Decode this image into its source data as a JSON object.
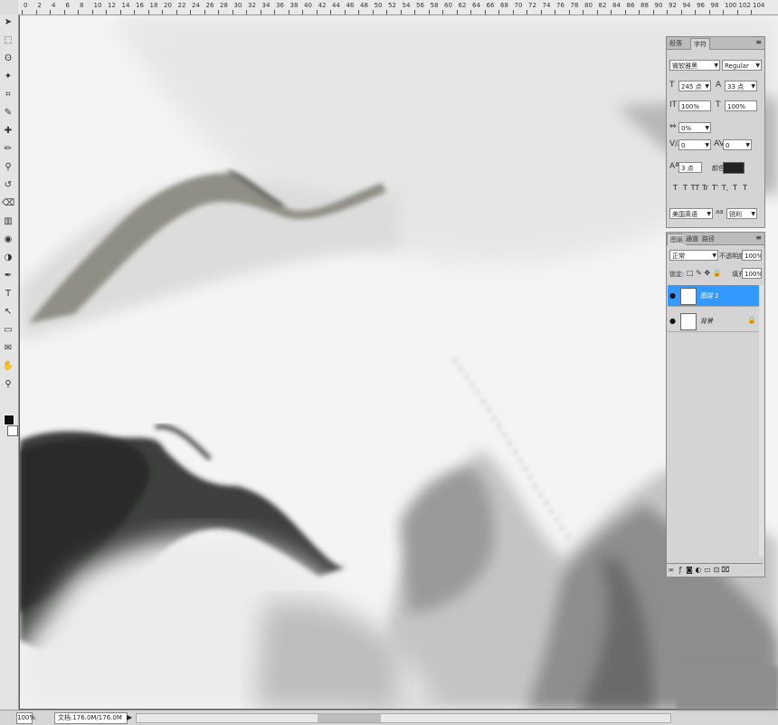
{
  "ruler": {
    "ticks": [
      "0",
      "2",
      "4",
      "6",
      "8",
      "10",
      "12",
      "14",
      "16",
      "18",
      "20",
      "22",
      "24",
      "26",
      "28",
      "30",
      "32",
      "34",
      "36",
      "38",
      "40",
      "42",
      "44",
      "46",
      "48",
      "50",
      "52",
      "54",
      "56",
      "58",
      "60",
      "62",
      "64",
      "66",
      "68",
      "70",
      "72",
      "74",
      "76",
      "78",
      "80",
      "82",
      "84",
      "86",
      "88",
      "90",
      "92",
      "94",
      "96",
      "98",
      "100",
      "102",
      "104"
    ]
  },
  "tools": [
    "move-tool-icon",
    "marquee-tool-icon",
    "lasso-tool-icon",
    "magic-wand-icon",
    "crop-tool-icon",
    "eyedropper-icon",
    "healing-brush-icon",
    "brush-tool-icon",
    "clone-stamp-icon",
    "history-brush-icon",
    "eraser-icon",
    "gradient-icon",
    "blur-tool-icon",
    "dodge-tool-icon",
    "pen-tool-icon",
    "type-tool-icon",
    "path-select-icon",
    "shape-tool-icon",
    "notes-icon",
    "hand-tool-icon",
    "zoom-tool-icon"
  ],
  "character": {
    "tabs": [
      "段落",
      "字符"
    ],
    "font_family": "微软雅黑",
    "font_style": "Regular",
    "font_size": "245 点",
    "leading": "33 点",
    "vscale": "100%",
    "hscale": "100%",
    "tracking_pct": "0%",
    "kerning": "0",
    "tracking": "0",
    "baseline": "3 点",
    "color_label": "颜色",
    "style_buttons": [
      "T",
      "T",
      "TT",
      "Tr",
      "T'",
      "T,",
      "T",
      "T"
    ],
    "language": "美国英语",
    "antialias_icon": "aa",
    "antialias": "锐利"
  },
  "layers": {
    "tabs": [
      "图层",
      "通道",
      "路径"
    ],
    "blend_mode": "正常",
    "opacity_label": "不透明度:",
    "opacity": "100%",
    "lock_label": "锁定:",
    "fill_label": "填充:",
    "fill": "100%",
    "items": [
      {
        "name": "图层 1",
        "selected": true
      },
      {
        "name": "背景",
        "selected": false
      }
    ]
  },
  "status": {
    "zoom": "100%",
    "doc": "文档:176.0M/176.0M"
  },
  "colors": {
    "selection": "#3399ff",
    "panel": "#d4d4d4",
    "workspace": "#5a5a5a"
  }
}
